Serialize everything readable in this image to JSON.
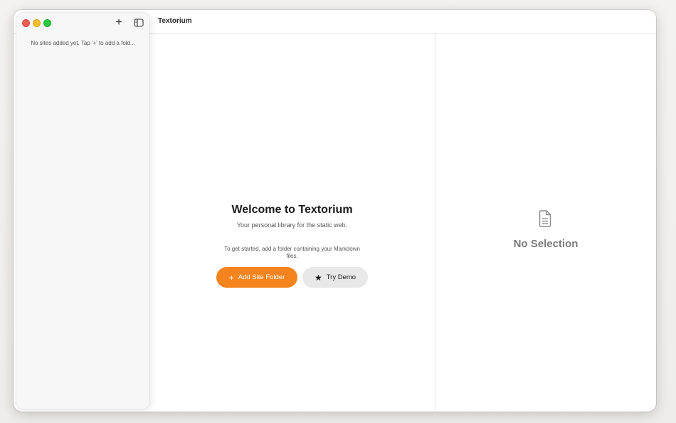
{
  "window": {
    "title": "Textorium"
  },
  "sidebar": {
    "empty_message": "No sites added yet. Tap '+' to add a fold...",
    "add_button_glyph": "+",
    "icons": {
      "add": "plus-icon",
      "toggle": "sidebar-toggle-icon"
    }
  },
  "welcome": {
    "title": "Welcome to Textorium",
    "subtitle": "Your personal library for the static web.",
    "hint": "To get started, add a folder containing your Markdown files.",
    "add_site_label": "Add Site Folder",
    "add_site_glyph": "+",
    "try_demo_label": "Try Demo",
    "try_demo_glyph": "★"
  },
  "detail": {
    "empty_title": "No Selection",
    "icon": "document-icon"
  },
  "colors": {
    "accent": "#f5841f",
    "close": "#ee5f57",
    "minimize": "#f6be2f",
    "maximize": "#2bc840"
  }
}
